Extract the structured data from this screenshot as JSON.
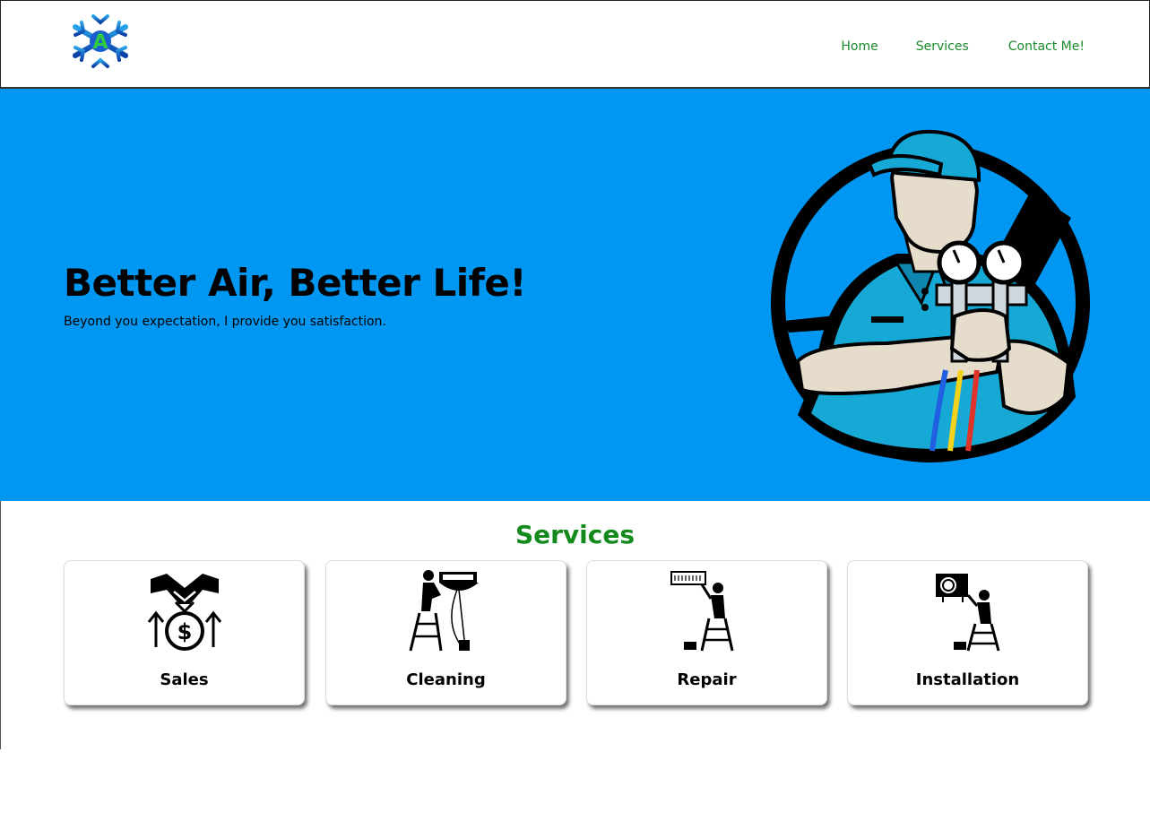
{
  "header": {
    "logo_letter": "A",
    "nav": {
      "home": "Home",
      "services": "Services",
      "contact": "Contact Me!"
    }
  },
  "hero": {
    "title": "Better Air, Better Life!",
    "subtitle": "Beyond you expectation, I provide you satisfaction.",
    "illustration_icon": "technician-with-gauges-icon"
  },
  "services": {
    "heading": "Services",
    "cards": [
      {
        "label": "Sales",
        "icon": "handshake-money-icon"
      },
      {
        "label": "Cleaning",
        "icon": "ac-cleaning-icon"
      },
      {
        "label": "Repair",
        "icon": "ac-repair-icon"
      },
      {
        "label": "Installation",
        "icon": "ac-installation-icon"
      }
    ]
  },
  "colors": {
    "hero_bg": "#0097f2",
    "nav_link": "#1a8a2a",
    "services_heading": "#148a1c",
    "technician_shirt": "#16a9d6"
  }
}
